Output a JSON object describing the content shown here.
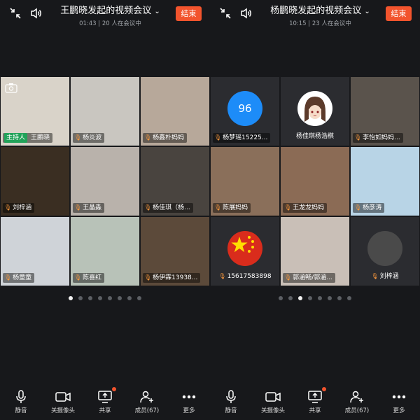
{
  "left": {
    "title": "王鹏晓发起的视频会议",
    "subtitle": "01:43 | 20 人在会议中",
    "end_label": "结束",
    "host_badge": "主持人",
    "tiles": [
      {
        "label": "王鹏晓",
        "host": true,
        "bg": "#d9d3c9"
      },
      {
        "label": "杨炎波",
        "bg": "#c9c6c0"
      },
      {
        "label": "杨鑫朴妈妈",
        "bg": "#b7a89a"
      },
      {
        "label": "刘梓涵",
        "bg": "#3a2e22"
      },
      {
        "label": "王晶淼",
        "bg": "#b9b2ab"
      },
      {
        "label": "杨佳琪（杨...",
        "bg": "#49443f"
      },
      {
        "label": "杨童童",
        "bg": "#cfd3d8"
      },
      {
        "label": "陈喜红",
        "bg": "#b8c2b8"
      },
      {
        "label": "杨伊霖13938...",
        "bg": "#5c4a3a"
      }
    ],
    "page_dots": 8,
    "active_dot": 0
  },
  "right": {
    "title": "杨鹏晓发起的视频会议",
    "subtitle": "10:15 | 23 人在会议中",
    "end_label": "结束",
    "tiles": [
      {
        "label": "杨梦瑶15225...",
        "bg": "#2b2c30",
        "avatar": "circle-96",
        "avatar_text": "96",
        "avatar_color": "#1d8cf8"
      },
      {
        "label": "杨佳琪杨浩棋",
        "bg": "#2b2c30",
        "avatar": "girl"
      },
      {
        "label": "李怡如妈妈...",
        "bg": "#5a534c"
      },
      {
        "label": "陈展妈妈",
        "bg": "#8a6f5a"
      },
      {
        "label": "王龙龙妈妈",
        "bg": "#8b6b55"
      },
      {
        "label": "杨彦涛",
        "bg": "#b8d4e6"
      },
      {
        "label": "15617583898",
        "bg": "#2b2c30",
        "avatar": "flag",
        "avatar_color": "#d92c1c"
      },
      {
        "label": "郭涵畅/郭涵...",
        "bg": "#c9bfb7"
      },
      {
        "label": "刘梓涵",
        "bg": "#2b2c30",
        "avatar": "dark"
      }
    ],
    "page_dots": 8,
    "active_dot": 2
  },
  "toolbar": [
    {
      "label": "静音",
      "icon": "microphone-icon"
    },
    {
      "label": "关摄像头",
      "icon": "camera-icon"
    },
    {
      "label": "共享",
      "icon": "share-screen-icon",
      "badge": true
    },
    {
      "label": "成员(67)",
      "icon": "members-icon"
    },
    {
      "label": "更多",
      "icon": "more-icon"
    },
    {
      "label": "静音",
      "icon": "microphone-icon"
    },
    {
      "label": "关摄像头",
      "icon": "camera-icon"
    },
    {
      "label": "共享",
      "icon": "share-screen-icon",
      "badge": true
    },
    {
      "label": "成员(67)",
      "icon": "members-icon"
    },
    {
      "label": "更多",
      "icon": "more-icon"
    }
  ],
  "colors": {
    "accent": "#f2542d",
    "host_badge": "#22a35a",
    "background": "#17181b"
  }
}
